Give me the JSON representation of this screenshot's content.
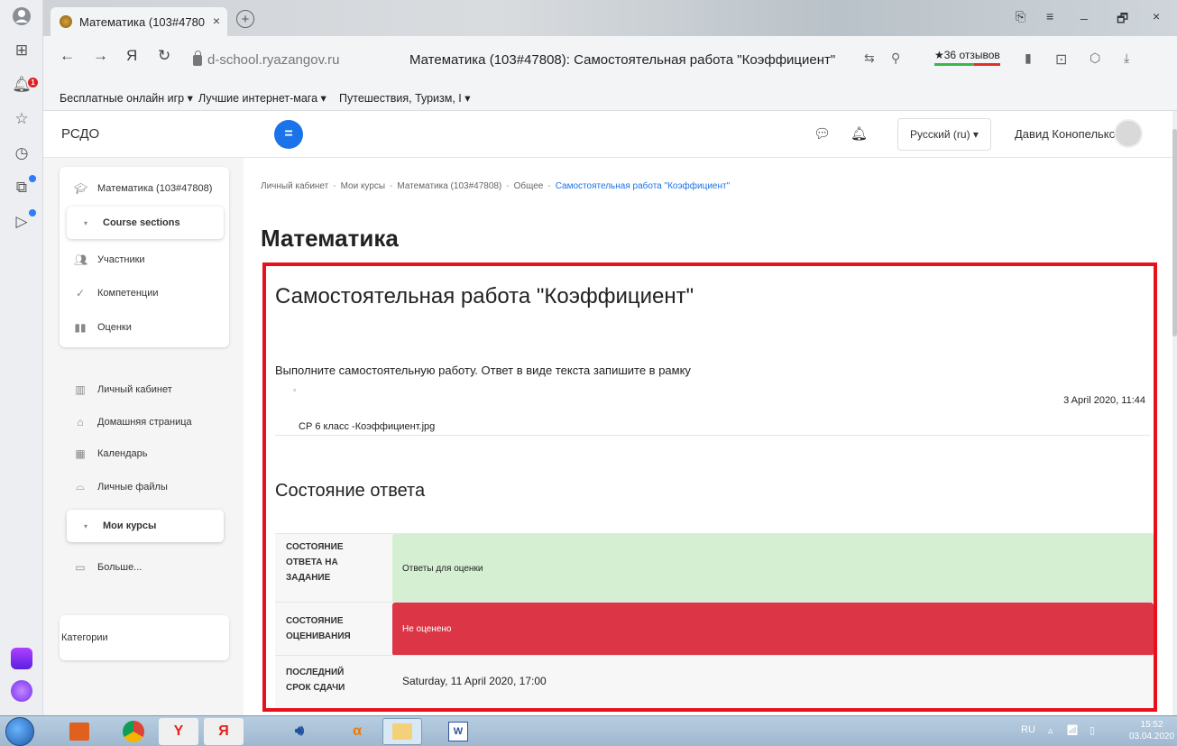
{
  "browser": {
    "tab_title": "Математика (103#4780",
    "tab_close": "×",
    "new_tab": "+",
    "nav_back": "←",
    "nav_forward": "→",
    "nav_yandex": "Я",
    "nav_reload": "↻",
    "url_host": "d-school.ryazangov.ru",
    "page_title": "Математика (103#47808): Самостоятельная работа \"Коэффициент\"",
    "reviews_label": "★36 отзывов",
    "left_badge": "1",
    "win_minimize": "_",
    "win_maximize": "🗗",
    "win_close": "×",
    "win_menu": "≡",
    "bookmarks": [
      "Бесплатные онлайн игр ▾",
      "Лучшие интернет-мага ▾",
      "Путешествия, Туризм, І ▾"
    ]
  },
  "site": {
    "brand": "РСДО",
    "menu_icon": "=",
    "language": "Русский (ru) ▾",
    "user_name": "Давид Конопелько"
  },
  "drawer": {
    "course": "Математика (103#47808)",
    "course_sections": "Course sections",
    "participants": "Участники",
    "competencies": "Компетенции",
    "grades": "Оценки",
    "dashboard": "Личный кабинет",
    "home": "Домашняя страница",
    "calendar": "Календарь",
    "files": "Личные файлы",
    "my_courses": "Мои курсы",
    "more": "Больше...",
    "categories": "Категории"
  },
  "breadcrumb": [
    "Личный кабинет",
    "Мои курсы",
    "Математика (103#47808)",
    "Общее",
    "Самостоятельная работа \"Коэффициент\""
  ],
  "breadcrumb_sep": "-",
  "page": {
    "course_title": "Математика",
    "assignment_title": "Самостоятельная работа \"Коэффициент\"",
    "intro": "Выполните самостоятельную работу. Ответ в виде текста запишите в рамку",
    "file_date": "3 April 2020, 11:44",
    "file_name": "СР 6 класс -Коэффициент.jpg",
    "status_heading": "Состояние ответа",
    "status": [
      {
        "label": "Состояние ответа на задание",
        "value": "Ответы для оценки"
      },
      {
        "label": "Состояние оценивания",
        "value": "Не оценено"
      },
      {
        "label": "Последний срок сдачи",
        "value": "Saturday, 11 April 2020, 17:00"
      }
    ]
  },
  "taskbar": {
    "lang": "RU",
    "time": "15:52",
    "date": "03.04.2020"
  }
}
